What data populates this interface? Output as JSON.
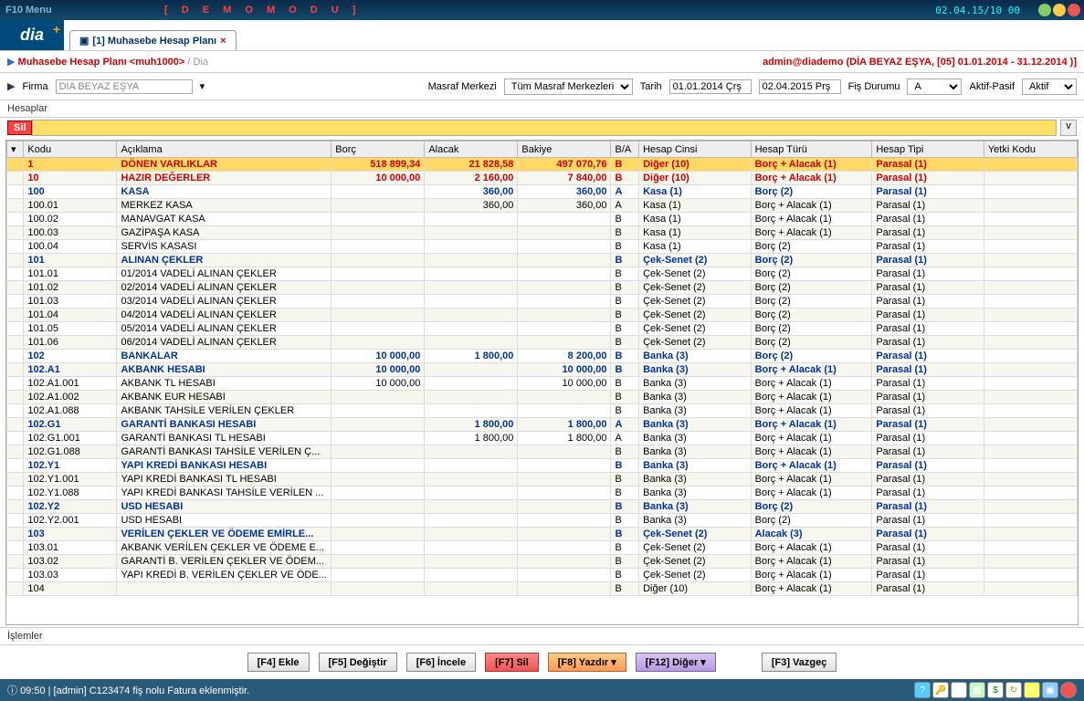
{
  "titlebar": {
    "f10": "F10 Menu",
    "demo": "[ D E M O   M O D U ]",
    "timestamp": "02.04.15/10 00"
  },
  "tab": {
    "label": "[1] Muhasebe Hesap Planı"
  },
  "crumbs": {
    "main": "Muhasebe Hesap Planı <muh1000>",
    "sub": " / Dia"
  },
  "ident": "admin@diademo (DİA BEYAZ EŞYA, [05] 01.01.2014 - 31.12.2014 )]",
  "filter": {
    "firma_label": "Firma",
    "firma_value": "DİA BEYAZ EŞYA",
    "masraf_label": "Masraf Merkezi",
    "masraf_value": "Tüm Masraf Merkezleri",
    "tarih_label": "Tarih",
    "tarih_from": "01.01.2014 Çrş",
    "tarih_to": "02.04.2015 Prş",
    "fis_label": "Fiş Durumu",
    "fis_value": "A",
    "aktif_label": "Aktif-Pasif",
    "aktif_value": "Aktif"
  },
  "section": "Hesaplar",
  "sil": "Sil",
  "columns": [
    "Kodu",
    "Açıklama",
    "Borç",
    "Alacak",
    "Bakiye",
    "B/A",
    "Hesap Cinsi",
    "Hesap Türü",
    "Hesap Tipi",
    "Yetki Kodu"
  ],
  "rows": [
    {
      "kodu": "1",
      "ack": "DÖNEN VARLIKLAR",
      "borc": "518 899,34",
      "alacak": "21 828,58",
      "bakiye": "497 070,76",
      "ba": "B",
      "cins": "Diğer (10)",
      "tur": "Borç + Alacak (1)",
      "tipi": "Parasal (1)",
      "yetki": "",
      "cls": "boldred sel"
    },
    {
      "kodu": "10",
      "ack": "HAZIR DEĞERLER",
      "borc": "10 000,00",
      "alacak": "2 160,00",
      "bakiye": "7 840,00",
      "ba": "B",
      "cins": "Diğer (10)",
      "tur": "Borç + Alacak (1)",
      "tipi": "Parasal (1)",
      "yetki": "",
      "cls": "boldred"
    },
    {
      "kodu": "100",
      "ack": "KASA",
      "borc": "",
      "alacak": "360,00",
      "bakiye": "360,00",
      "ba": "A",
      "cins": "Kasa (1)",
      "tur": "Borç (2)",
      "tipi": "Parasal (1)",
      "yetki": "",
      "cls": "bold"
    },
    {
      "kodu": "100.01",
      "ack": "MERKEZ KASA",
      "borc": "",
      "alacak": "360,00",
      "bakiye": "360,00",
      "ba": "A",
      "cins": "Kasa (1)",
      "tur": "Borç + Alacak (1)",
      "tipi": "Parasal (1)",
      "yetki": "",
      "cls": ""
    },
    {
      "kodu": "100.02",
      "ack": "MANAVGAT KASA",
      "borc": "",
      "alacak": "",
      "bakiye": "",
      "ba": "B",
      "cins": "Kasa (1)",
      "tur": "Borç + Alacak (1)",
      "tipi": "Parasal (1)",
      "yetki": "",
      "cls": ""
    },
    {
      "kodu": "100.03",
      "ack": "GAZİPAŞA KASA",
      "borc": "",
      "alacak": "",
      "bakiye": "",
      "ba": "B",
      "cins": "Kasa (1)",
      "tur": "Borç + Alacak (1)",
      "tipi": "Parasal (1)",
      "yetki": "",
      "cls": ""
    },
    {
      "kodu": "100.04",
      "ack": "SERVİS KASASI",
      "borc": "",
      "alacak": "",
      "bakiye": "",
      "ba": "B",
      "cins": "Kasa (1)",
      "tur": "Borç (2)",
      "tipi": "Parasal (1)",
      "yetki": "",
      "cls": ""
    },
    {
      "kodu": "101",
      "ack": "ALINAN ÇEKLER",
      "borc": "",
      "alacak": "",
      "bakiye": "",
      "ba": "B",
      "cins": "Çek-Senet (2)",
      "tur": "Borç (2)",
      "tipi": "Parasal (1)",
      "yetki": "",
      "cls": "bold"
    },
    {
      "kodu": "101.01",
      "ack": "01/2014 VADELİ ALINAN ÇEKLER",
      "borc": "",
      "alacak": "",
      "bakiye": "",
      "ba": "B",
      "cins": "Çek-Senet (2)",
      "tur": "Borç (2)",
      "tipi": "Parasal (1)",
      "yetki": "",
      "cls": ""
    },
    {
      "kodu": "101.02",
      "ack": "02/2014 VADELİ ALINAN ÇEKLER",
      "borc": "",
      "alacak": "",
      "bakiye": "",
      "ba": "B",
      "cins": "Çek-Senet (2)",
      "tur": "Borç (2)",
      "tipi": "Parasal (1)",
      "yetki": "",
      "cls": ""
    },
    {
      "kodu": "101.03",
      "ack": "03/2014 VADELİ ALINAN ÇEKLER",
      "borc": "",
      "alacak": "",
      "bakiye": "",
      "ba": "B",
      "cins": "Çek-Senet (2)",
      "tur": "Borç (2)",
      "tipi": "Parasal (1)",
      "yetki": "",
      "cls": ""
    },
    {
      "kodu": "101.04",
      "ack": "04/2014 VADELİ ALINAN ÇEKLER",
      "borc": "",
      "alacak": "",
      "bakiye": "",
      "ba": "B",
      "cins": "Çek-Senet (2)",
      "tur": "Borç (2)",
      "tipi": "Parasal (1)",
      "yetki": "",
      "cls": ""
    },
    {
      "kodu": "101.05",
      "ack": "05/2014 VADELİ ALINAN ÇEKLER",
      "borc": "",
      "alacak": "",
      "bakiye": "",
      "ba": "B",
      "cins": "Çek-Senet (2)",
      "tur": "Borç (2)",
      "tipi": "Parasal (1)",
      "yetki": "",
      "cls": ""
    },
    {
      "kodu": "101.06",
      "ack": "06/2014 VADELİ ALINAN ÇEKLER",
      "borc": "",
      "alacak": "",
      "bakiye": "",
      "ba": "B",
      "cins": "Çek-Senet (2)",
      "tur": "Borç (2)",
      "tipi": "Parasal (1)",
      "yetki": "",
      "cls": ""
    },
    {
      "kodu": "102",
      "ack": "BANKALAR",
      "borc": "10 000,00",
      "alacak": "1 800,00",
      "bakiye": "8 200,00",
      "ba": "B",
      "cins": "Banka (3)",
      "tur": "Borç (2)",
      "tipi": "Parasal (1)",
      "yetki": "",
      "cls": "bold"
    },
    {
      "kodu": "102.A1",
      "ack": "AKBANK HESABI",
      "borc": "10 000,00",
      "alacak": "",
      "bakiye": "10 000,00",
      "ba": "B",
      "cins": "Banka (3)",
      "tur": "Borç + Alacak (1)",
      "tipi": "Parasal (1)",
      "yetki": "",
      "cls": "bold"
    },
    {
      "kodu": "102.A1.001",
      "ack": "AKBANK TL HESABI",
      "borc": "10 000,00",
      "alacak": "",
      "bakiye": "10 000,00",
      "ba": "B",
      "cins": "Banka (3)",
      "tur": "Borç + Alacak (1)",
      "tipi": "Parasal (1)",
      "yetki": "",
      "cls": ""
    },
    {
      "kodu": "102.A1.002",
      "ack": "AKBANK EUR HESABI",
      "borc": "",
      "alacak": "",
      "bakiye": "",
      "ba": "B",
      "cins": "Banka (3)",
      "tur": "Borç + Alacak (1)",
      "tipi": "Parasal (1)",
      "yetki": "",
      "cls": ""
    },
    {
      "kodu": "102.A1.088",
      "ack": "AKBANK TAHSİLE VERİLEN ÇEKLER",
      "borc": "",
      "alacak": "",
      "bakiye": "",
      "ba": "B",
      "cins": "Banka (3)",
      "tur": "Borç + Alacak (1)",
      "tipi": "Parasal (1)",
      "yetki": "",
      "cls": ""
    },
    {
      "kodu": "102.G1",
      "ack": "GARANTİ BANKASI HESABI",
      "borc": "",
      "alacak": "1 800,00",
      "bakiye": "1 800,00",
      "ba": "A",
      "cins": "Banka (3)",
      "tur": "Borç + Alacak (1)",
      "tipi": "Parasal (1)",
      "yetki": "",
      "cls": "bold"
    },
    {
      "kodu": "102.G1.001",
      "ack": "GARANTİ BANKASI TL HESABI",
      "borc": "",
      "alacak": "1 800,00",
      "bakiye": "1 800,00",
      "ba": "A",
      "cins": "Banka (3)",
      "tur": "Borç + Alacak (1)",
      "tipi": "Parasal (1)",
      "yetki": "",
      "cls": ""
    },
    {
      "kodu": "102.G1.088",
      "ack": "GARANTİ BANKASI TAHSİLE VERİLEN Ç...",
      "borc": "",
      "alacak": "",
      "bakiye": "",
      "ba": "B",
      "cins": "Banka (3)",
      "tur": "Borç + Alacak (1)",
      "tipi": "Parasal (1)",
      "yetki": "",
      "cls": ""
    },
    {
      "kodu": "102.Y1",
      "ack": "YAPI KREDİ BANKASI HESABI",
      "borc": "",
      "alacak": "",
      "bakiye": "",
      "ba": "B",
      "cins": "Banka (3)",
      "tur": "Borç + Alacak (1)",
      "tipi": "Parasal (1)",
      "yetki": "",
      "cls": "bold"
    },
    {
      "kodu": "102.Y1.001",
      "ack": "YAPI KREDİ BANKASI TL HESABI",
      "borc": "",
      "alacak": "",
      "bakiye": "",
      "ba": "B",
      "cins": "Banka (3)",
      "tur": "Borç + Alacak (1)",
      "tipi": "Parasal (1)",
      "yetki": "",
      "cls": ""
    },
    {
      "kodu": "102.Y1.088",
      "ack": "YAPI KREDİ BANKASI TAHSİLE VERİLEN ...",
      "borc": "",
      "alacak": "",
      "bakiye": "",
      "ba": "B",
      "cins": "Banka (3)",
      "tur": "Borç + Alacak (1)",
      "tipi": "Parasal (1)",
      "yetki": "",
      "cls": ""
    },
    {
      "kodu": "102.Y2",
      "ack": "USD HESABI",
      "borc": "",
      "alacak": "",
      "bakiye": "",
      "ba": "B",
      "cins": "Banka (3)",
      "tur": "Borç (2)",
      "tipi": "Parasal (1)",
      "yetki": "",
      "cls": "bold"
    },
    {
      "kodu": "102.Y2.001",
      "ack": "USD HESABI",
      "borc": "",
      "alacak": "",
      "bakiye": "",
      "ba": "B",
      "cins": "Banka (3)",
      "tur": "Borç (2)",
      "tipi": "Parasal (1)",
      "yetki": "",
      "cls": ""
    },
    {
      "kodu": "103",
      "ack": "VERİLEN ÇEKLER VE ÖDEME EMİRLE...",
      "borc": "",
      "alacak": "",
      "bakiye": "",
      "ba": "B",
      "cins": "Çek-Senet (2)",
      "tur": "Alacak (3)",
      "tipi": "Parasal (1)",
      "yetki": "",
      "cls": "bold"
    },
    {
      "kodu": "103.01",
      "ack": "AKBANK VERİLEN ÇEKLER VE ÖDEME E...",
      "borc": "",
      "alacak": "",
      "bakiye": "",
      "ba": "B",
      "cins": "Çek-Senet (2)",
      "tur": "Borç + Alacak (1)",
      "tipi": "Parasal (1)",
      "yetki": "",
      "cls": ""
    },
    {
      "kodu": "103.02",
      "ack": "GARANTİ B. VERİLEN ÇEKLER VE ÖDEM...",
      "borc": "",
      "alacak": "",
      "bakiye": "",
      "ba": "B",
      "cins": "Çek-Senet (2)",
      "tur": "Borç + Alacak (1)",
      "tipi": "Parasal (1)",
      "yetki": "",
      "cls": ""
    },
    {
      "kodu": "103.03",
      "ack": "YAPI KREDİ B. VERİLEN ÇEKLER VE ÖDE...",
      "borc": "",
      "alacak": "",
      "bakiye": "",
      "ba": "B",
      "cins": "Çek-Senet (2)",
      "tur": "Borç + Alacak (1)",
      "tipi": "Parasal (1)",
      "yetki": "",
      "cls": ""
    },
    {
      "kodu": "104",
      "ack": "",
      "borc": "",
      "alacak": "",
      "bakiye": "",
      "ba": "B",
      "cins": "Diğer (10)",
      "tur": "Borç + Alacak (1)",
      "tipi": "Parasal (1)",
      "yetki": "",
      "cls": ""
    }
  ],
  "sub": "İşlemler",
  "buttons": {
    "ekle": "[F4] Ekle",
    "degistir": "[F5] Değiştir",
    "incele": "[F6] İncele",
    "sil": "[F7] Sil",
    "yazdir": "[F8] Yazdır ▾",
    "diger": "[F12] Diğer ▾",
    "vazgec": "[F3] Vazgeç"
  },
  "status": "09:50  |  [admin] C123474 fiş nolu Fatura eklenmiştir."
}
